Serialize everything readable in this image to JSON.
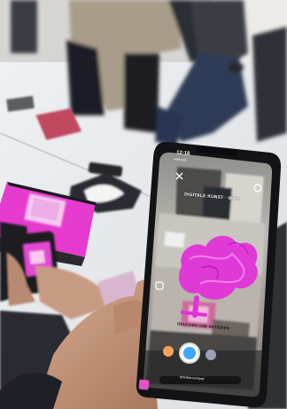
{
  "status_bar": {
    "time": "12:18",
    "back_label": "◂ Bereich"
  },
  "ar_view": {
    "top_caption": "DIGITALE KUNST · WMH",
    "bottom_caption": "DRUCKEN UND ROTIEREN",
    "url_text": "gmedias.com/ptsf"
  },
  "colors": {
    "magenta": "#e033d8",
    "phone_body": "#141416",
    "table": "#e9ebee",
    "skin": "#c99b80"
  }
}
